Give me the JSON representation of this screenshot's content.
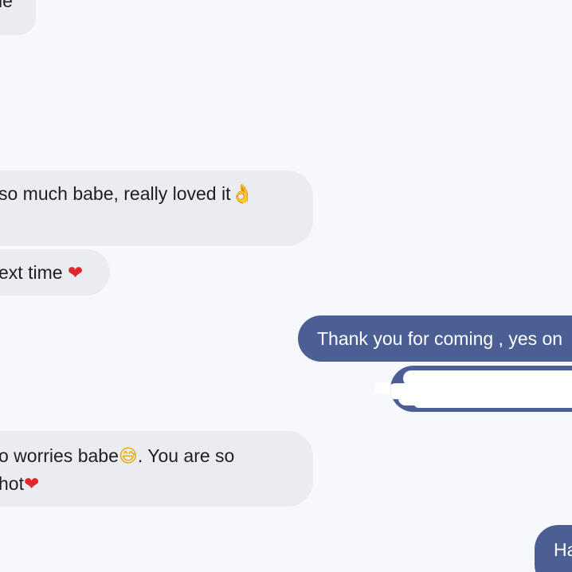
{
  "messages": [
    {
      "direction": "incoming",
      "text": "le"
    },
    {
      "direction": "incoming",
      "text": "so much babe, really loved it",
      "emoji": "👌"
    },
    {
      "direction": "incoming",
      "text": "ext time",
      "emoji": "❤"
    },
    {
      "direction": "outgoing",
      "text": "Thank you for coming , yes on"
    },
    {
      "direction": "outgoing",
      "redacted": true
    },
    {
      "direction": "incoming",
      "line1": "o worries babe",
      "emoji1": "😅",
      "line1_rest": ". You are so",
      "line2": "hot",
      "emoji2": "❤"
    },
    {
      "direction": "outgoing",
      "text": "Ha"
    }
  ],
  "colors": {
    "background": "#f7f8fc",
    "incoming_bubble": "#ebecf2",
    "outgoing_bubble": "#4b5f94",
    "outgoing_text": "#ffffff",
    "incoming_text": "#1f1f1f"
  }
}
